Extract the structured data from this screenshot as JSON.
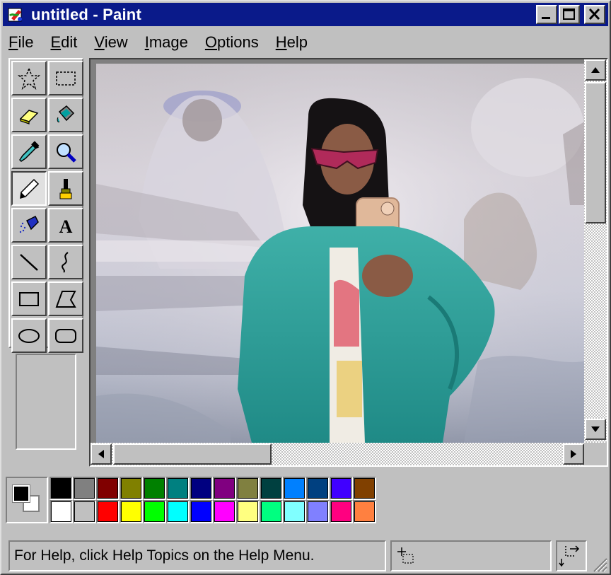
{
  "window": {
    "title": "untitled - Paint",
    "title_bar_color": "#0a1a8a",
    "controls": [
      "minimize-icon",
      "maximize-icon",
      "close-icon"
    ]
  },
  "menu": [
    {
      "first": "F",
      "rest": "ile"
    },
    {
      "first": "E",
      "rest": "dit"
    },
    {
      "first": "V",
      "rest": "iew"
    },
    {
      "first": "I",
      "rest": "mage"
    },
    {
      "first": "O",
      "rest": "ptions"
    },
    {
      "first": "H",
      "rest": "elp"
    }
  ],
  "tools": [
    {
      "name": "free-form-select",
      "icon": "star-select-icon",
      "active": false
    },
    {
      "name": "rect-select",
      "icon": "rect-select-icon",
      "active": false
    },
    {
      "name": "eraser",
      "icon": "eraser-icon",
      "active": false
    },
    {
      "name": "fill",
      "icon": "paint-bucket-icon",
      "active": false
    },
    {
      "name": "pick-color",
      "icon": "eyedropper-icon",
      "active": false
    },
    {
      "name": "magnifier",
      "icon": "magnifier-icon",
      "active": false
    },
    {
      "name": "pencil",
      "icon": "pencil-icon",
      "active": true
    },
    {
      "name": "brush",
      "icon": "brush-icon",
      "active": false
    },
    {
      "name": "airbrush",
      "icon": "airbrush-icon",
      "active": false
    },
    {
      "name": "text",
      "icon": "text-icon",
      "active": false,
      "glyph": "A"
    },
    {
      "name": "line",
      "icon": "line-icon",
      "active": false
    },
    {
      "name": "curve",
      "icon": "curve-icon",
      "active": false
    },
    {
      "name": "rectangle",
      "icon": "rectangle-icon",
      "active": false
    },
    {
      "name": "polygon",
      "icon": "polygon-icon",
      "active": false
    },
    {
      "name": "ellipse",
      "icon": "ellipse-icon",
      "active": false
    },
    {
      "name": "rounded-rectangle",
      "icon": "rounded-rect-icon",
      "active": false
    }
  ],
  "palette": {
    "foreground": "#000000",
    "background": "#ffffff",
    "row1": [
      "#000000",
      "#808080",
      "#800000",
      "#808000",
      "#008000",
      "#008080",
      "#000080",
      "#800080",
      "#808040",
      "#004040",
      "#0080ff",
      "#004080",
      "#4000ff",
      "#804000"
    ],
    "row2": [
      "#ffffff",
      "#c0c0c0",
      "#ff0000",
      "#ffff00",
      "#00ff00",
      "#00ffff",
      "#0000ff",
      "#ff00ff",
      "#ffff80",
      "#00ff80",
      "#80ffff",
      "#8080ff",
      "#ff0080",
      "#ff8040"
    ]
  },
  "status": {
    "help_text": "For Help, click Help Topics on the Help Menu."
  }
}
